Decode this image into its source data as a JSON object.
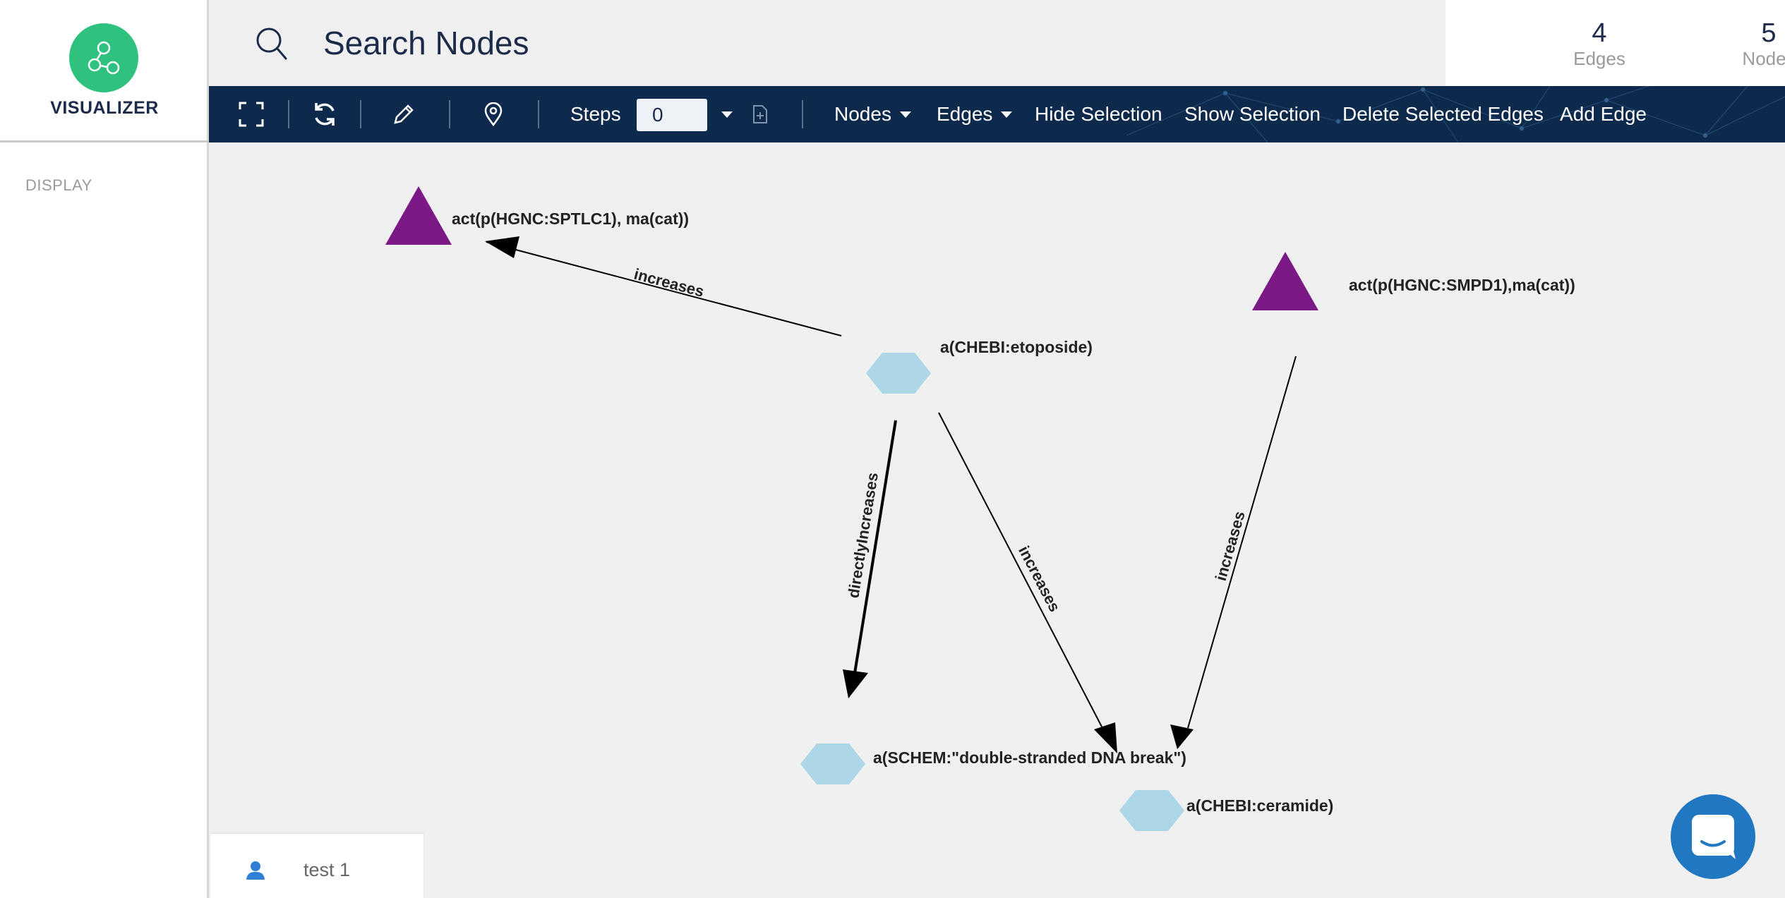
{
  "app": {
    "name": "VISUALIZER"
  },
  "sidebar": {
    "section_label": "DISPLAY"
  },
  "search": {
    "placeholder": "Search Nodes"
  },
  "stats": {
    "edges": {
      "count": "4",
      "label": "Edges"
    },
    "nodes": {
      "count": "5",
      "label": "Nodes"
    }
  },
  "toolbar": {
    "steps_label": "Steps",
    "steps_value": "0",
    "nodes_menu": "Nodes",
    "edges_menu": "Edges",
    "hide_selection": "Hide Selection",
    "show_selection": "Show Selection",
    "delete_selected_edges": "Delete Selected Edges",
    "add_edge": "Add Edge"
  },
  "colors": {
    "accent": "#2ec27e",
    "toolbar_bg": "#0d2a4d",
    "triangle_node": "#7b1a86",
    "hexagon_node": "#acd7e6",
    "chat_button": "#1f78c1"
  },
  "graph": {
    "nodes": [
      {
        "id": "n1",
        "label": "act(p(HGNC:SPTLC1), ma(cat))",
        "shape": "triangle"
      },
      {
        "id": "n2",
        "label": "act(p(HGNC:SMPD1),ma(cat))",
        "shape": "triangle"
      },
      {
        "id": "n3",
        "label": "a(CHEBI:etoposide)",
        "shape": "hexagon"
      },
      {
        "id": "n4",
        "label": "a(SCHEM:\"double-stranded DNA break\")",
        "shape": "hexagon"
      },
      {
        "id": "n5",
        "label": "a(CHEBI:ceramide)",
        "shape": "hexagon"
      }
    ],
    "edges": [
      {
        "label": "increases",
        "source": "n3",
        "target": "n1"
      },
      {
        "label": "directlyIncreases",
        "source": "n3",
        "target": "n4"
      },
      {
        "label": "increases",
        "source": "n3",
        "target": "n5"
      },
      {
        "label": "increases",
        "source": "n2",
        "target": "n5"
      }
    ]
  },
  "user": {
    "name": "test 1"
  }
}
